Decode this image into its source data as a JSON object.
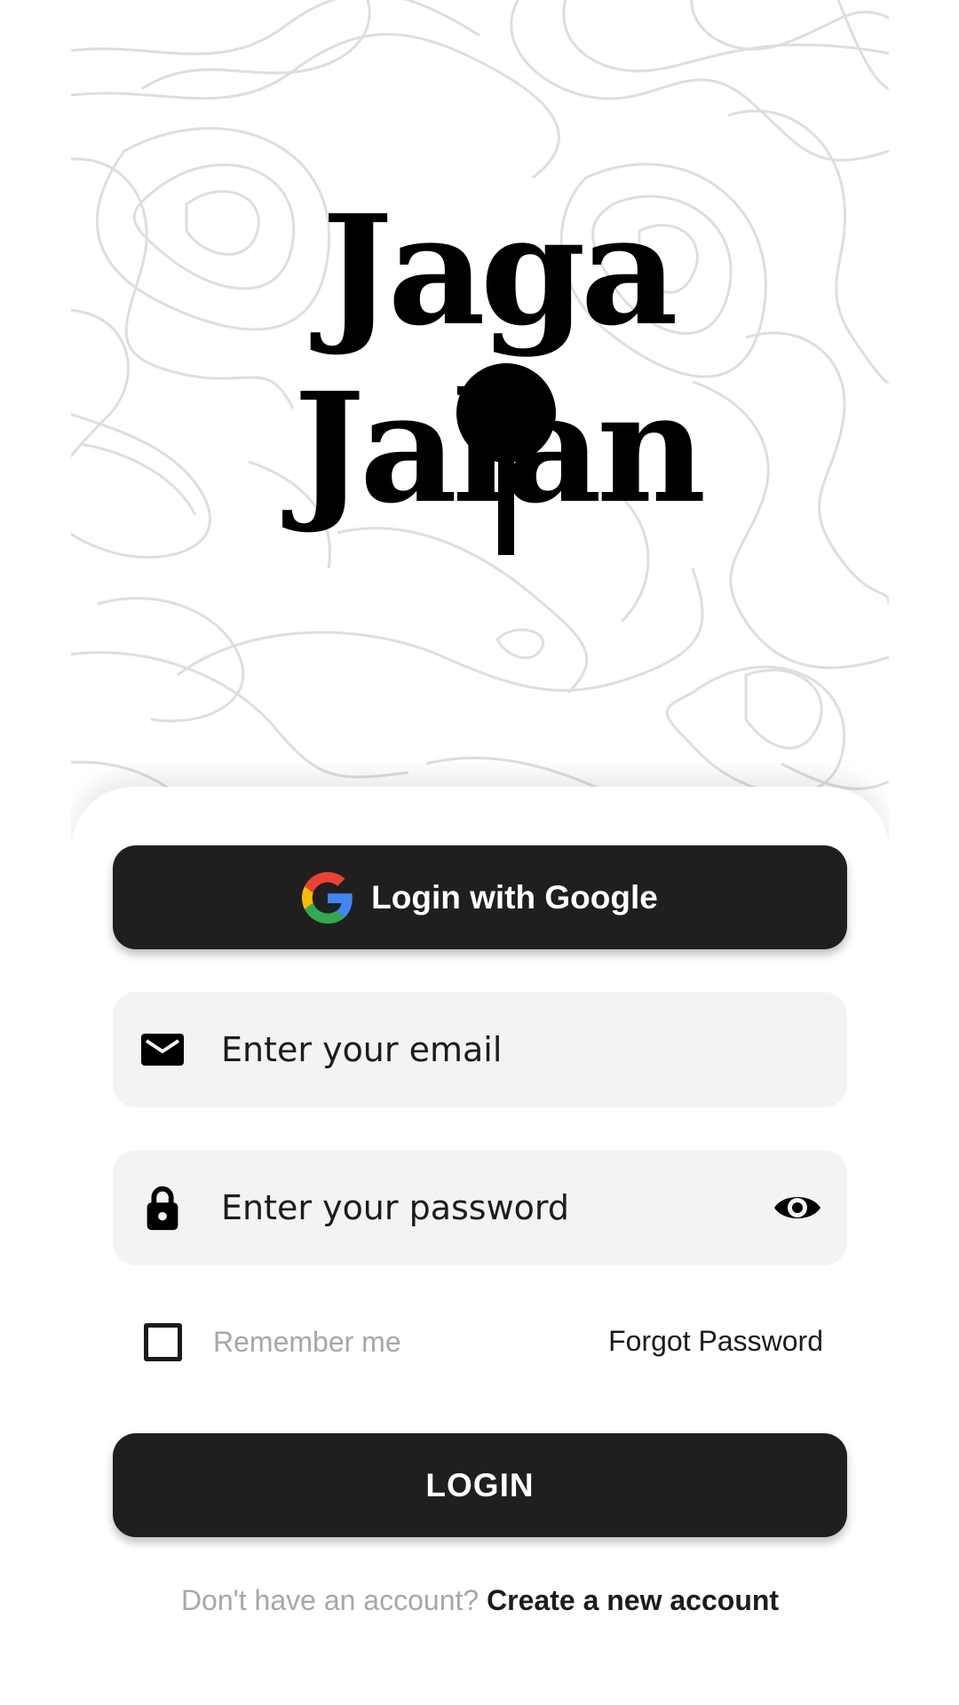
{
  "app": {
    "logo_text_line1": "Jaga",
    "logo_text_line2": "Jalan"
  },
  "login": {
    "google_button_label": "Login with Google",
    "email_placeholder": "Enter your email",
    "password_placeholder": "Enter your password",
    "remember_label": "Remember me",
    "remember_checked": false,
    "forgot_label": "Forgot Password",
    "login_button_label": "LOGIN",
    "signup_prompt": "Don't have an account?",
    "signup_link": "Create a new account"
  },
  "icons": {
    "google": "google-g-icon",
    "email": "envelope-icon",
    "password": "lock-icon",
    "visibility": "eye-icon"
  },
  "colors": {
    "primary_button": "#1f1f1f",
    "field_background": "#f2f3f5",
    "muted_text": "#a4a7ad",
    "text": "#1c1c1c",
    "contour_lines": "#dedede"
  }
}
